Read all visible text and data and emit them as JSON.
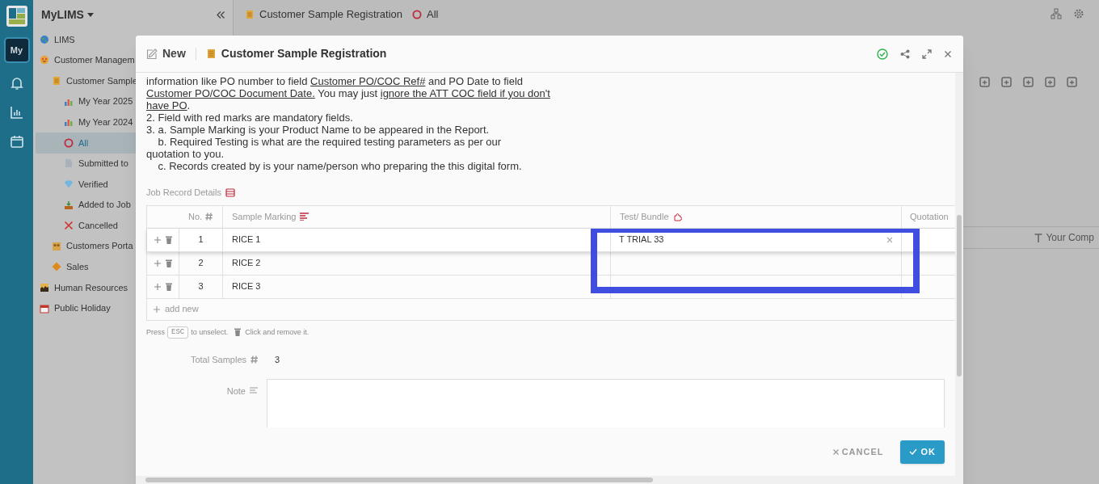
{
  "rail": {
    "avatar": {
      "label": "My",
      "selected": true
    }
  },
  "sidebar": {
    "title": "MyLIMS",
    "items": [
      {
        "label": "LIMS",
        "selected": false
      },
      {
        "label": "Customer Managem",
        "selected": false,
        "children": [
          {
            "label": "Customer Sample",
            "selected": false,
            "children": [
              {
                "label": "My Year 2025",
                "selected": false
              },
              {
                "label": "My Year 2024",
                "selected": false
              },
              {
                "label": "All",
                "selected": true
              },
              {
                "label": "Submitted to",
                "selected": false
              },
              {
                "label": "Verified",
                "selected": false
              },
              {
                "label": "Added to Job",
                "selected": false
              },
              {
                "label": "Cancelled",
                "selected": false
              }
            ]
          },
          {
            "label": "Customers Porta",
            "selected": false
          },
          {
            "label": "Sales",
            "selected": false
          }
        ]
      },
      {
        "label": "Human Resources",
        "selected": false
      },
      {
        "label": "Public Holiday",
        "selected": false
      }
    ]
  },
  "header": {
    "title": "Customer Sample Registration",
    "view": "All"
  },
  "background_table": {
    "column": "Your Comp"
  },
  "dialog": {
    "mode": "New",
    "title": "Customer Sample Registration",
    "instructions": [
      [
        {
          "text": "information like PO number to field "
        },
        {
          "text": "Customer PO/COC Ref#",
          "underline": true
        },
        {
          "text": " and PO Date to field"
        }
      ],
      [
        {
          "text": "Customer PO/COC Document Date.",
          "underline": true
        },
        {
          "text": " You may just "
        },
        {
          "text": "ignore the ATT COC field if you don't",
          "underline": true
        }
      ],
      [
        {
          "text": "have PO",
          "underline": true
        },
        {
          "text": "."
        }
      ],
      [
        {
          "text": "2. Field with red marks are mandatory fields."
        }
      ],
      [
        {
          "text": "3. a. Sample Marking is your Product Name to be appeared in the Report."
        }
      ],
      [
        {
          "text": "    b. Required Testing is what are the required testing parameters as per our"
        }
      ],
      [
        {
          "text": "quotation to you."
        }
      ],
      [
        {
          "text": "    c. Records created by is your name/person who preparing the this digital form."
        }
      ]
    ],
    "section_label": "Job Record Details",
    "table": {
      "columns": [
        "No.",
        "Sample Marking",
        "Test/ Bundle",
        "Quotation"
      ],
      "rows": [
        {
          "no": "1",
          "sample_marking": "RICE 1",
          "test_bundle": "T TRIAL 33",
          "selected": true
        },
        {
          "no": "2",
          "sample_marking": "RICE 2",
          "test_bundle": "",
          "selected": false
        },
        {
          "no": "3",
          "sample_marking": "RICE 3",
          "test_bundle": "",
          "selected": false
        }
      ],
      "add_new": "add new"
    },
    "hint": {
      "press": "Press",
      "key": "ESC",
      "unselect": "to unselect.",
      "remove": "Click and remove it."
    },
    "total_samples": {
      "label": "Total Samples",
      "value": "3"
    },
    "note": {
      "label": "Note"
    },
    "buttons": {
      "cancel": "CANCEL",
      "ok": "OK"
    }
  }
}
